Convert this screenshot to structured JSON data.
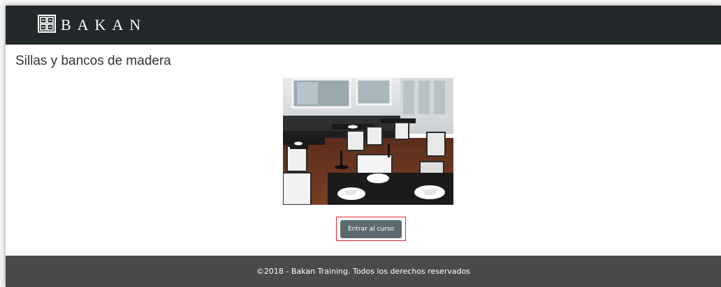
{
  "header": {
    "brand_name": "BAKAN",
    "logo_icon": "bakan-logo-icon"
  },
  "main": {
    "title": "Sillas y bancos de madera",
    "image_subject": "restaurant-dining-room-photo",
    "enter_button_label": "Entrar al curso",
    "highlight_color": "#e0262b",
    "button_color": "#5d6b70"
  },
  "footer": {
    "copyright": "©2018 - Bakan Training. Todos los derechos reservados"
  },
  "colors": {
    "navbar": "#23282a",
    "footer": "#4a4a4a"
  }
}
